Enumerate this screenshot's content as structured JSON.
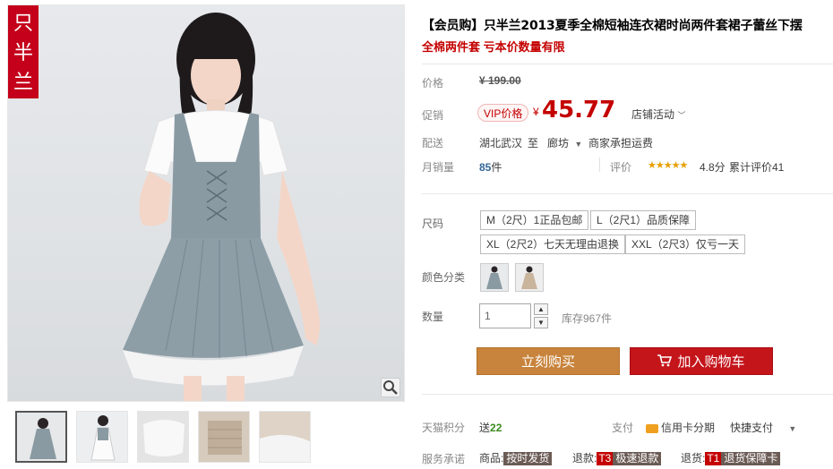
{
  "brand": {
    "logo_chars": [
      "只",
      "半",
      "兰"
    ]
  },
  "product": {
    "title": "【会员购】只半兰2013夏季全棉短袖连衣裙时尚两件套裙子蕾丝下摆",
    "subtitle": "全棉两件套 亏本价数量有限"
  },
  "price": {
    "label": "价格",
    "original": "¥ 199.00",
    "promo_label": "促销",
    "vip_badge": "VIP价格",
    "currency": "¥",
    "current": "45.77",
    "store_event": "店铺活动"
  },
  "shipping": {
    "label": "配送",
    "from": "湖北武汉",
    "to_word": "至",
    "to": "廊坊",
    "fee": "商家承担运费"
  },
  "sales": {
    "label": "月销量",
    "count": "85",
    "unit": "件",
    "rating_label": "评价",
    "stars": "★★★★★",
    "score": "4.8分",
    "total_reviews": "累计评价41",
    "rating_value": 4.8
  },
  "sizes": {
    "label": "尺码",
    "options": [
      "M（2尺）1正品包邮",
      "L（2尺1）品质保障",
      "XL（2尺2）七天无理由退换",
      "XXL（2尺3）仅亏一天"
    ]
  },
  "colors": {
    "label": "颜色分类"
  },
  "quantity": {
    "label": "数量",
    "value": "1",
    "stock": "库存967件"
  },
  "actions": {
    "buy_now": "立刻购买",
    "add_to_cart": "加入购物车"
  },
  "points": {
    "label": "天猫积分",
    "give": "送",
    "amount": "22"
  },
  "payment": {
    "label": "支付",
    "credit": "信用卡分期",
    "quick": "快捷支付"
  },
  "service": {
    "label": "服务承诺",
    "item1_prefix": "商品:",
    "item1_tag": "按时发货",
    "item2_prefix": "退款:",
    "item2_code": "T3",
    "item2_tag": "极速退款",
    "item3_prefix": "退货:",
    "item3_code": "T1",
    "item3_tag": "退货保障卡"
  },
  "colors_theme": {
    "accent": "#c40000",
    "buy": "#c8843c",
    "cart": "#c4151b"
  }
}
